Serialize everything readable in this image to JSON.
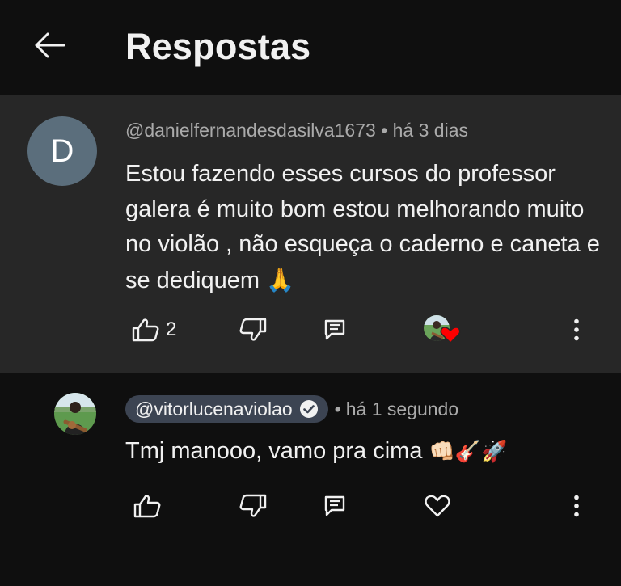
{
  "header": {
    "title": "Respostas",
    "back_icon": "arrow-left-icon"
  },
  "parent_comment": {
    "avatar_letter": "D",
    "avatar_color": "#5b6e7c",
    "author": "@danielfernandesdasilva1673",
    "separator": "•",
    "time": "há 3 dias",
    "text": "Estou fazendo esses cursos do professor galera é muito bom estou melhorando muito no violão , não esqueça o caderno e caneta e se dediquem",
    "emoji": "🙏",
    "like_count": "2",
    "icons": {
      "like": "thumbs-up-icon",
      "dislike": "thumbs-down-icon",
      "reply": "comment-icon",
      "creator_heart": "creator-heart-icon",
      "more": "more-vertical-icon"
    }
  },
  "reply": {
    "author": "@vitorlucenaviolao",
    "verified_icon": "verified-check-icon",
    "separator": "•",
    "time": "há 1 segundo",
    "text": "Tmj manooo, vamo pra cima",
    "emojis": "👊🏻🎸🚀",
    "icons": {
      "like": "thumbs-up-icon",
      "dislike": "thumbs-down-icon",
      "reply": "comment-icon",
      "heart": "heart-outline-icon",
      "more": "more-vertical-icon"
    }
  },
  "colors": {
    "background": "#0f0f0f",
    "parent_background": "#272727",
    "chip_background": "#3c4452",
    "heart_red": "#ff0000",
    "secondary_text": "#aaaaaa",
    "primary_text": "#f1f1f1"
  }
}
